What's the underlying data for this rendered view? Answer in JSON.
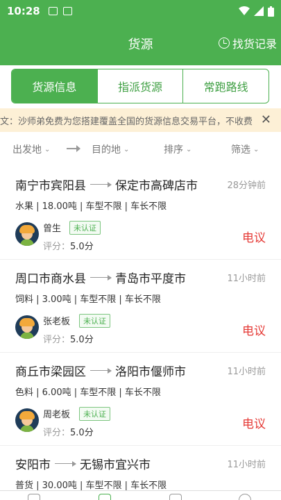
{
  "status": {
    "time": "10:28"
  },
  "header": {
    "title": "货源",
    "history_label": "找货记录"
  },
  "tabs": [
    {
      "label": "货源信息"
    },
    {
      "label": "指派货源"
    },
    {
      "label": "常跑路线"
    }
  ],
  "notice": {
    "text": "文：沙师弟免费为您搭建覆盖全国的货源信息交易平台，不收费",
    "close": "✕"
  },
  "filters": {
    "origin": "出发地",
    "destination": "目的地",
    "sort": "排序",
    "filter": "筛选",
    "chevron": "⌄"
  },
  "listings": [
    {
      "from": "南宁市宾阳县",
      "to": "保定市高碑店市",
      "time": "28分钟前",
      "details": "水果 | 18.00吨 | 车型不限 | 车长不限",
      "name": "曾生",
      "badge": "未认证",
      "rating_label": "评分：",
      "rating": "5.0分",
      "action": "电议"
    },
    {
      "from": "周口市商水县",
      "to": "青岛市平度市",
      "time": "11小时前",
      "details": "饲料 | 3.00吨 | 车型不限 | 车长不限",
      "name": "张老板",
      "badge": "未认证",
      "rating_label": "评分：",
      "rating": "5.0分",
      "action": "电议"
    },
    {
      "from": "商丘市梁园区",
      "to": "洛阳市偃师市",
      "time": "11小时前",
      "details": "色料 | 6.00吨 | 车型不限 | 车长不限",
      "name": "周老板",
      "badge": "未认证",
      "rating_label": "评分：",
      "rating": "5.0分",
      "action": "电议"
    },
    {
      "from": "安阳市",
      "to": "无锡市宜兴市",
      "time": "11小时前",
      "details": "普货 | 30.00吨 | 车型不限 | 车长不限"
    }
  ],
  "colors": {
    "brand": "#4cb050",
    "accent_red": "#e53935",
    "notice_bg": "#fdf0d6"
  }
}
